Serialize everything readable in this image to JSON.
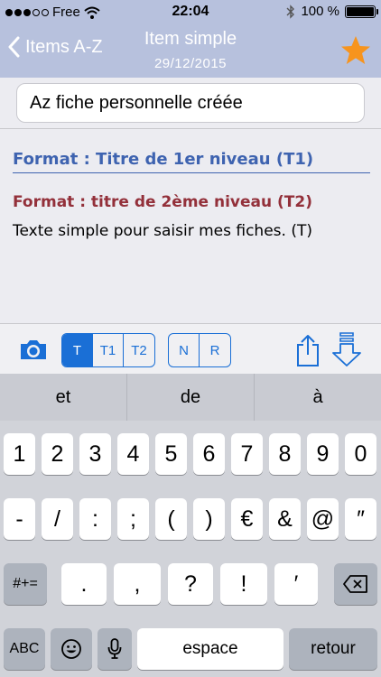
{
  "status": {
    "carrier": "Free",
    "time": "22:04",
    "battery": "100 %",
    "battery_level": 1.0,
    "signal_bars_filled": 3,
    "signal_bars_total": 5
  },
  "nav": {
    "back_label": "Items A-Z",
    "title": "Item simple",
    "date": "29/12/2015",
    "favorite_color": "#f7941d"
  },
  "content": {
    "title_value": "Az fiche personnelle créée",
    "t1": "Format : Titre de 1er niveau (T1)",
    "t2": "Format : titre de 2ème niveau (T2)",
    "text": "Texte simple pour saisir mes fiches. (T)"
  },
  "toolbar": {
    "style_buttons": [
      "T",
      "T1",
      "T2"
    ],
    "active_style": "T",
    "nr_buttons": [
      "N",
      "R"
    ],
    "accent": "#1a6fd6"
  },
  "keyboard": {
    "suggestions": [
      "et",
      "de",
      "à"
    ],
    "row1": [
      "1",
      "2",
      "3",
      "4",
      "5",
      "6",
      "7",
      "8",
      "9",
      "0"
    ],
    "row2": [
      "-",
      "/",
      ":",
      ";",
      "(",
      ")",
      "€",
      "&",
      "@",
      "″"
    ],
    "row3_left": "#+=",
    "row3": [
      ".",
      ",",
      "?",
      "!",
      "′"
    ],
    "abc": "ABC",
    "space": "espace",
    "return": "retour"
  }
}
